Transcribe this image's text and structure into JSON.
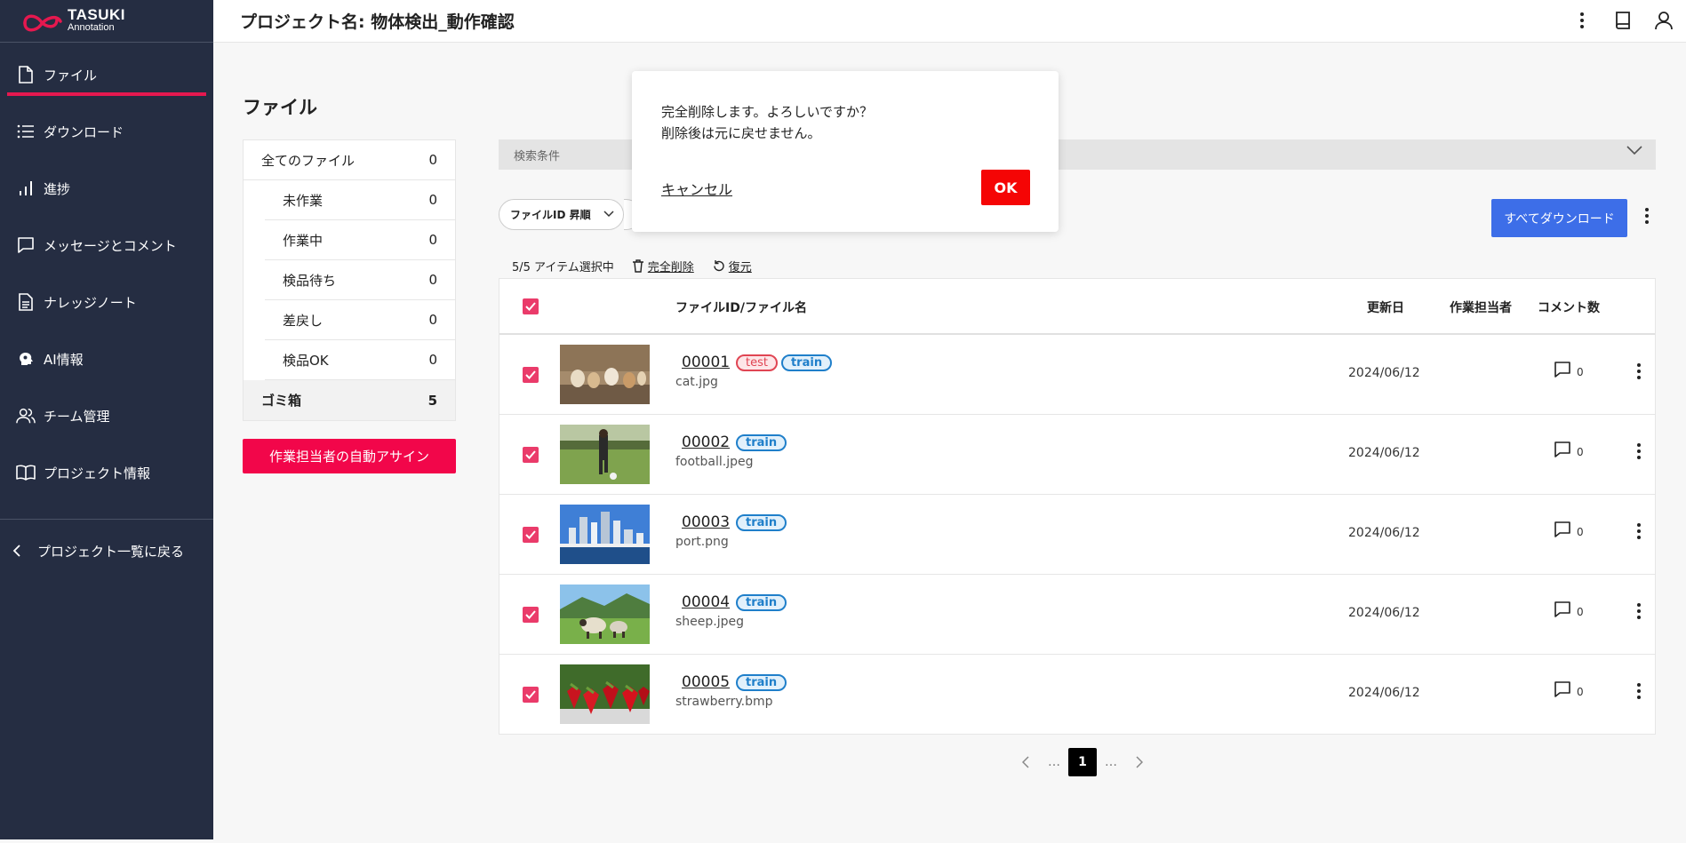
{
  "app": {
    "logo_line1": "TASUKI",
    "logo_line2": "Annotation",
    "brand_color": "#e5184f"
  },
  "header": {
    "project_title": "プロジェクト名: 物体検出_動作確認"
  },
  "sidebar": {
    "items": [
      {
        "label": "ファイル",
        "icon": "file-icon",
        "active": true
      },
      {
        "label": "ダウンロード",
        "icon": "list-icon"
      },
      {
        "label": "進捗",
        "icon": "bar-chart-icon"
      },
      {
        "label": "メッセージとコメント",
        "icon": "message-icon"
      },
      {
        "label": "ナレッジノート",
        "icon": "document-icon"
      },
      {
        "label": "AI情報",
        "icon": "ai-head-icon"
      },
      {
        "label": "チーム管理",
        "icon": "users-icon"
      },
      {
        "label": "プロジェクト情報",
        "icon": "book-icon"
      }
    ],
    "back_label": "プロジェクト一覧に戻る"
  },
  "main": {
    "title": "ファイル",
    "status_filters": [
      {
        "label": "全てのファイル",
        "count": "0"
      },
      {
        "label": "未作業",
        "count": "0"
      },
      {
        "label": "作業中",
        "count": "0"
      },
      {
        "label": "検品待ち",
        "count": "0"
      },
      {
        "label": "差戻し",
        "count": "0"
      },
      {
        "label": "検品OK",
        "count": "0"
      },
      {
        "label": "ゴミ箱",
        "count": "5"
      }
    ],
    "assign_button": "作業担当者の自動アサイン",
    "search_label": "検索条件",
    "sort_label": "ファイルID 昇順",
    "download_all": "すべてダウンロード",
    "selection": {
      "text": "5/5 アイテム選択中",
      "delete": "完全削除",
      "restore": "復元"
    },
    "table": {
      "headers": {
        "file": "ファイルID/ファイル名",
        "updated": "更新日",
        "assignee": "作業担当者",
        "comments": "コメント数"
      },
      "rows": [
        {
          "id": "00001",
          "name": "cat.jpg",
          "tags": [
            "test",
            "train"
          ],
          "date": "2024/06/12",
          "comments": "0"
        },
        {
          "id": "00002",
          "name": "football.jpeg",
          "tags": [
            "train"
          ],
          "date": "2024/06/12",
          "comments": "0"
        },
        {
          "id": "00003",
          "name": "port.png",
          "tags": [
            "train"
          ],
          "date": "2024/06/12",
          "comments": "0"
        },
        {
          "id": "00004",
          "name": "sheep.jpeg",
          "tags": [
            "train"
          ],
          "date": "2024/06/12",
          "comments": "0"
        },
        {
          "id": "00005",
          "name": "strawberry.bmp",
          "tags": [
            "train"
          ],
          "date": "2024/06/12",
          "comments": "0"
        }
      ]
    },
    "pagination": {
      "current": "1",
      "ellipsis": "…"
    }
  },
  "dialog": {
    "line1": "完全削除します。よろしいですか？",
    "line2": "削除後は元に戻せません。",
    "cancel": "キャンセル",
    "ok": "OK"
  }
}
